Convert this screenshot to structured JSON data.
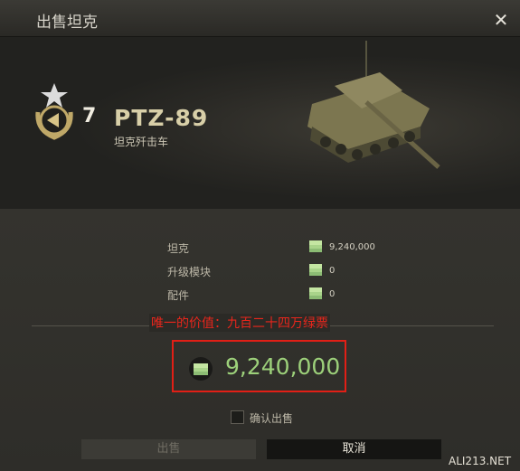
{
  "dialog": {
    "title": "出售坦克",
    "close_icon": "close-icon"
  },
  "tank": {
    "tier": "7",
    "name": "PTZ-89",
    "type": "坦克歼击车",
    "badge_icon": "tank-destroyer-tier-badge-icon"
  },
  "breakdown": [
    {
      "label": "坦克",
      "value": "9,240,000"
    },
    {
      "label": "升级模块",
      "value": "0"
    },
    {
      "label": "配件",
      "value": "0"
    }
  ],
  "annotation": "唯一的价值：九百二十四万绿票",
  "total": {
    "value": "9,240,000",
    "currency_icon": "credits-icon"
  },
  "confirm": {
    "label": "确认出售",
    "checked": false
  },
  "buttons": {
    "sell": "出售",
    "cancel": "取消"
  },
  "watermark": "ALI213.NET",
  "colors": {
    "price_green": "#9cd07a",
    "annotation_red": "#e8261c"
  }
}
